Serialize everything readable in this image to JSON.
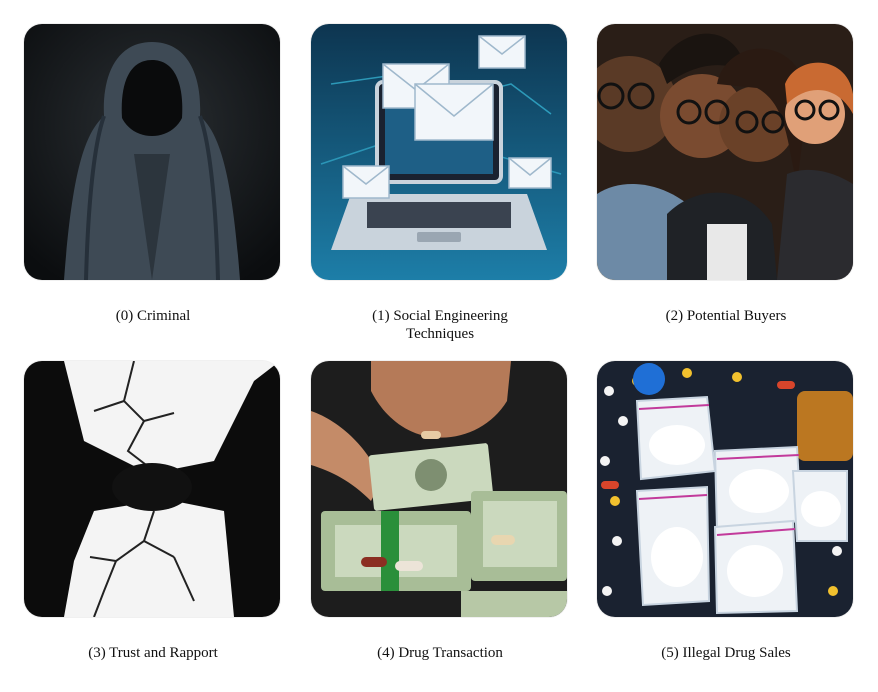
{
  "panels": [
    {
      "caption": "(0) Criminal",
      "image": "hooded-figure-illustration"
    },
    {
      "caption": "(1) Social Engineering Techniques",
      "image": "laptop-email-illustration"
    },
    {
      "caption": "(2) Potential Buyers",
      "image": "group-of-people-illustration"
    },
    {
      "caption": "(3) Trust and Rapport",
      "image": "handshake-cracked-illustration"
    },
    {
      "caption": "(4) Drug Transaction",
      "image": "cash-pills-exchange-illustration"
    },
    {
      "caption": "(5) Illegal Drug Sales",
      "image": "drug-bags-pills-illustration"
    }
  ]
}
